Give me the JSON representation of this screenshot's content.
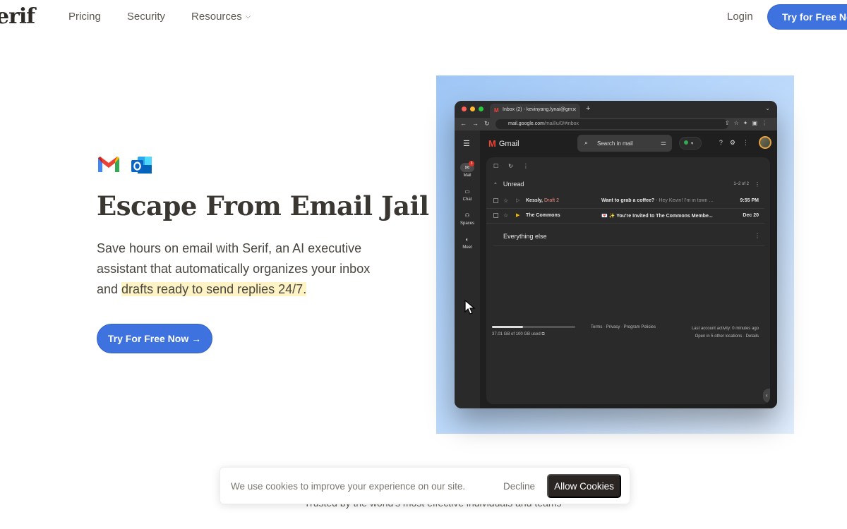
{
  "header": {
    "logo": "erif",
    "nav": [
      {
        "label": "Pricing"
      },
      {
        "label": "Security"
      },
      {
        "label": "Resources"
      }
    ],
    "login": "Login",
    "cta": "Try for Free Now"
  },
  "hero": {
    "title": "Escape From Email Jail",
    "subtitle_plain": "Save hours on email with Serif, an AI executive assistant that automatically organizes your inbox and ",
    "subtitle_highlight": "drafts ready to send replies 24/7.",
    "cta": "Try For Free Now →",
    "integrations": [
      "gmail-icon",
      "outlook-icon"
    ]
  },
  "screenshot": {
    "tab_title": "Inbox (2) - kevinyang.lynai@gm",
    "url_host": "mail.google.com",
    "url_path": "/mail/u/0/#inbox",
    "gmail_label": "Gmail",
    "search_placeholder": "Search in mail",
    "rail": [
      {
        "label": "Mail",
        "badge": "3"
      },
      {
        "label": "Chat"
      },
      {
        "label": "Spaces"
      },
      {
        "label": "Meet"
      }
    ],
    "section_unread": "Unread",
    "unread_count": "1–2 of 2",
    "rows": [
      {
        "from": "Kessly,",
        "draft": "Draft 2",
        "subject": "Want to grab a coffee?",
        "snippet": " - Hey Kevin! I'm in town ...",
        "date": "9:55 PM"
      },
      {
        "from": "The Commons",
        "draft": "",
        "subject": "💌 ✨ You're Invited to The Commons Membe...",
        "snippet": "",
        "date": "Dec 20"
      }
    ],
    "section_else": "Everything else",
    "storage_text": "37.01 GB of 100 GB used",
    "storage_fraction": 0.37,
    "footer_links": "Terms · Privacy · Program Policies",
    "activity": "Last account activity: 0 minutes ago",
    "activity_sub": "Open in 5 other locations · Details"
  },
  "cookie": {
    "message": "We use cookies to improve your experience on our site.",
    "decline": "Decline",
    "allow": "Allow Cookies"
  },
  "trusted_text": "Trusted by the world's most effective individuals and teams",
  "colors": {
    "accent": "#3e72de",
    "highlight": "#fdf3c4",
    "panel_gradient": "#9ec6f5"
  }
}
